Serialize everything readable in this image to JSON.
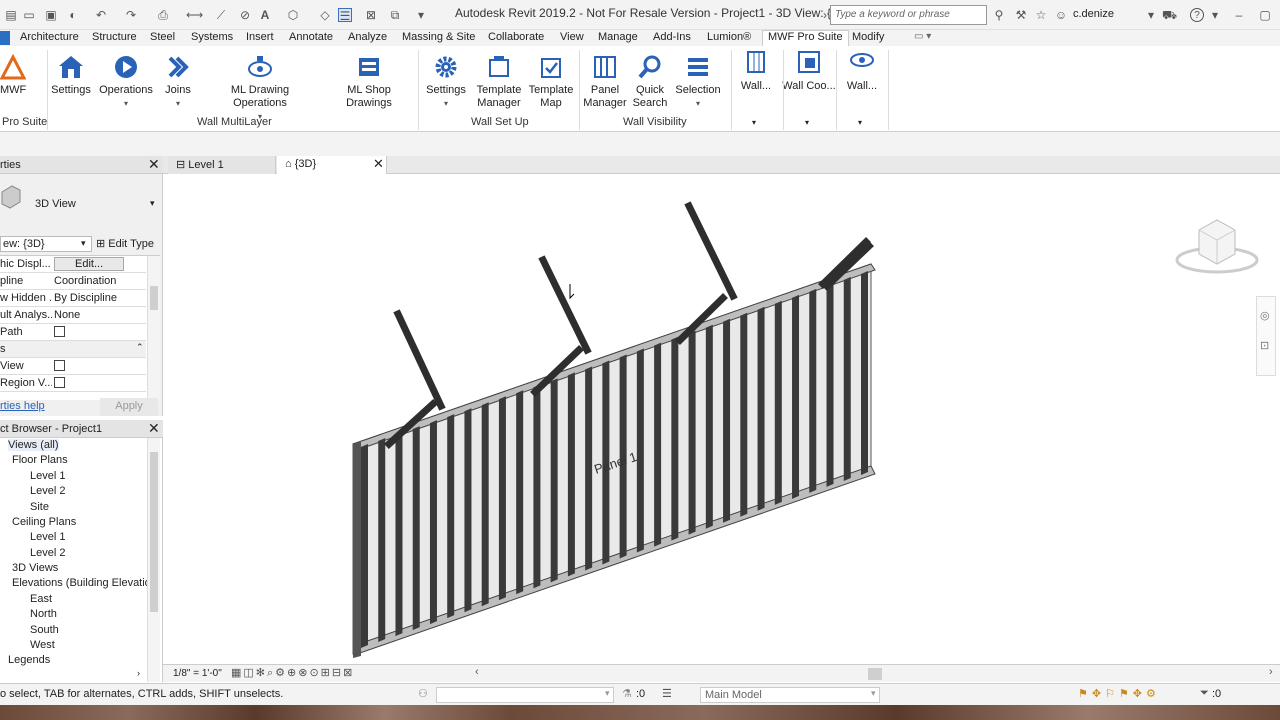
{
  "title_bar": {
    "app_title": "Autodesk Revit 2019.2 - Not For Resale Version - Project1 - 3D View: {3D}",
    "search_placeholder": "Type a keyword or phrase",
    "username": "c.denize"
  },
  "ribbon_tabs": [
    "Architecture",
    "Structure",
    "Steel",
    "Systems",
    "Insert",
    "Annotate",
    "Analyze",
    "Massing & Site",
    "Collaborate",
    "View",
    "Manage",
    "Add-Ins",
    "Lumion®",
    "MWF Pro Suite",
    "Modify"
  ],
  "active_tab": "MWF Pro Suite",
  "ribbon": {
    "mwf_label": "MWF",
    "pro_suite_group": "Pro Suite",
    "multilayer": {
      "group": "Wall MultiLayer",
      "buttons": [
        "Settings",
        "Operations",
        "Joins",
        "ML Drawing Operations",
        "ML Shop Drawings"
      ]
    },
    "setup": {
      "group": "Wall Set Up",
      "settings": "Settings",
      "template_manager_1": "Template",
      "template_manager_2": "Manager",
      "template_map_1": "Template",
      "template_map_2": "Map"
    },
    "visibility": {
      "group": "Wall Visibility",
      "panel_manager_1": "Panel",
      "panel_manager_2": "Manager",
      "quick_search_1": "Quick",
      "quick_search_2": "Search",
      "selection": "Selection"
    },
    "extra": [
      "Wall...",
      "Wall Coo...",
      "Wall..."
    ]
  },
  "properties": {
    "header": "rties",
    "type_name": "3D View",
    "view_selector": "ew: {3D}",
    "edit_type": "Edit Type",
    "rows": [
      {
        "key": "hic Displ...",
        "value": "Edit..."
      },
      {
        "key": "pline",
        "value": "Coordination"
      },
      {
        "key": "w Hidden ...",
        "value": "By Discipline"
      },
      {
        "key": "ult Analys...",
        "value": "None"
      },
      {
        "key": "Path",
        "value": ""
      }
    ],
    "section": "s",
    "rows2": [
      {
        "key": "View",
        "value": ""
      },
      {
        "key": "Region V...",
        "value": ""
      }
    ],
    "help_link": "rties help",
    "apply": "Apply"
  },
  "browser": {
    "header": "ct Browser - Project1",
    "nodes": [
      {
        "label": "Views (all)",
        "level": 0
      },
      {
        "label": "Floor Plans",
        "level": 1
      },
      {
        "label": "Level 1",
        "level": 2
      },
      {
        "label": "Level 2",
        "level": 2
      },
      {
        "label": "Site",
        "level": 2
      },
      {
        "label": "Ceiling Plans",
        "level": 1
      },
      {
        "label": "Level 1",
        "level": 2
      },
      {
        "label": "Level 2",
        "level": 2
      },
      {
        "label": "3D Views",
        "level": 1
      },
      {
        "label": "Elevations (Building Elevatio",
        "level": 1
      },
      {
        "label": "East",
        "level": 2
      },
      {
        "label": "North",
        "level": 2
      },
      {
        "label": "South",
        "level": 2
      },
      {
        "label": "West",
        "level": 2
      },
      {
        "label": "Legends",
        "level": 1
      }
    ]
  },
  "view_tabs": [
    {
      "label": "Level 1"
    },
    {
      "label": "{3D}"
    }
  ],
  "viewport": {
    "panel_label": "Panel 1"
  },
  "view_control": {
    "scale": "1/8\" = 1'-0\""
  },
  "status": {
    "message": "o select, TAB for alternates, CTRL adds, SHIFT unselects.",
    "zero_a": ":0",
    "model": "Main Model",
    "zero_b": ":0"
  }
}
